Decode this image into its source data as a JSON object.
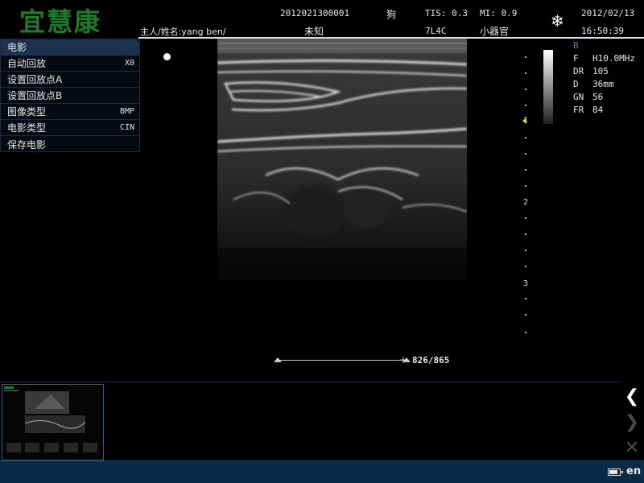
{
  "header": {
    "logo": "宜慧康",
    "patient_id": "2012021300001",
    "species": "狗",
    "tis": "TIS: 0.3",
    "mi": "MI: 0.9",
    "date": "2012/02/13",
    "owner_name": "主人/姓名:yang ben/",
    "breed": "未知",
    "probe": "7L4C",
    "preset": "小器官",
    "time": "16:50:39",
    "freeze_icon": "snowflake-icon"
  },
  "cine_menu": {
    "title": "电影",
    "items": [
      {
        "label": "自动回放",
        "value": "X0"
      },
      {
        "label": "设置回放点A",
        "value": ""
      },
      {
        "label": "设置回放点B",
        "value": ""
      },
      {
        "label": "图像类型",
        "value": "BMP"
      },
      {
        "label": "电影类型",
        "value": "CIN"
      },
      {
        "label": "保存电影",
        "value": ""
      }
    ]
  },
  "depth_scale": {
    "labels": [
      "1",
      "2",
      "3"
    ],
    "focus_marker_color": "#e8d820"
  },
  "params": {
    "mode": "B",
    "rows": [
      {
        "key": "F",
        "value": "H10.0MHz"
      },
      {
        "key": "DR",
        "value": "105"
      },
      {
        "key": "D",
        "value": "36mm"
      },
      {
        "key": "GN",
        "value": "56"
      },
      {
        "key": "FR",
        "value": "84"
      }
    ]
  },
  "cine": {
    "counter": "826/865"
  },
  "nav": {
    "prev_icon": "chevron-left-icon",
    "next_icon": "chevron-right-icon",
    "close_icon": "close-icon"
  },
  "status": {
    "language": "en",
    "battery_icon": "battery-icon"
  },
  "colors": {
    "logo_green": "#1e7a2c",
    "status_bar": "#0a2a48",
    "menu_title": "#1c3350"
  }
}
